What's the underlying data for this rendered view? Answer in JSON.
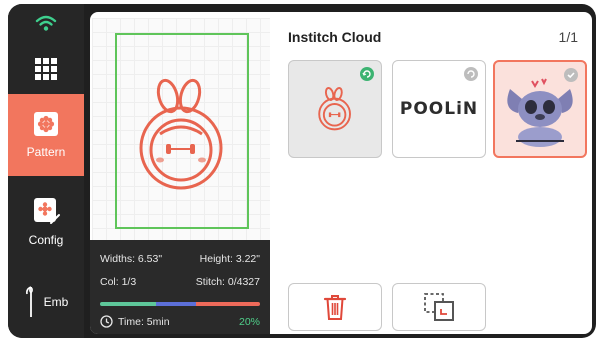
{
  "sidebar": {
    "items": [
      {
        "id": "wifi",
        "icon": "wifi-icon"
      },
      {
        "id": "apps",
        "icon": "grid-icon"
      },
      {
        "id": "pattern",
        "label": "Pattern",
        "icon": "pattern-icon",
        "active": true
      },
      {
        "id": "config",
        "label": "Config",
        "icon": "config-icon"
      },
      {
        "id": "emb",
        "label": "Emb",
        "icon": "needle-icon"
      }
    ]
  },
  "preview": {
    "widths": "Widths: 6.53\"",
    "height": "Height: 3.22\"",
    "col": "Col: 1/3",
    "stitch": "Stitch: 0/4327",
    "time": "Time: 5min",
    "percent": "20%",
    "progress_colors": [
      "#5ec79a",
      "#5c6fd8",
      "#ee6a5a"
    ],
    "progress": 0.2
  },
  "cloud": {
    "title": "Institch Cloud",
    "pager": "1/1",
    "cards": [
      {
        "name": "bunny-pattern",
        "status": "synced"
      },
      {
        "name": "poolin-logo",
        "logo_text": "POOLiN",
        "status": "pending"
      },
      {
        "name": "stitch-pattern",
        "status": "selected"
      }
    ]
  },
  "actions": {
    "delete": "trash-icon",
    "copy": "copy-icon"
  },
  "colors": {
    "accent": "#f2765e",
    "hoop": "#5fc55a",
    "wifi": "#3ecf8e"
  }
}
